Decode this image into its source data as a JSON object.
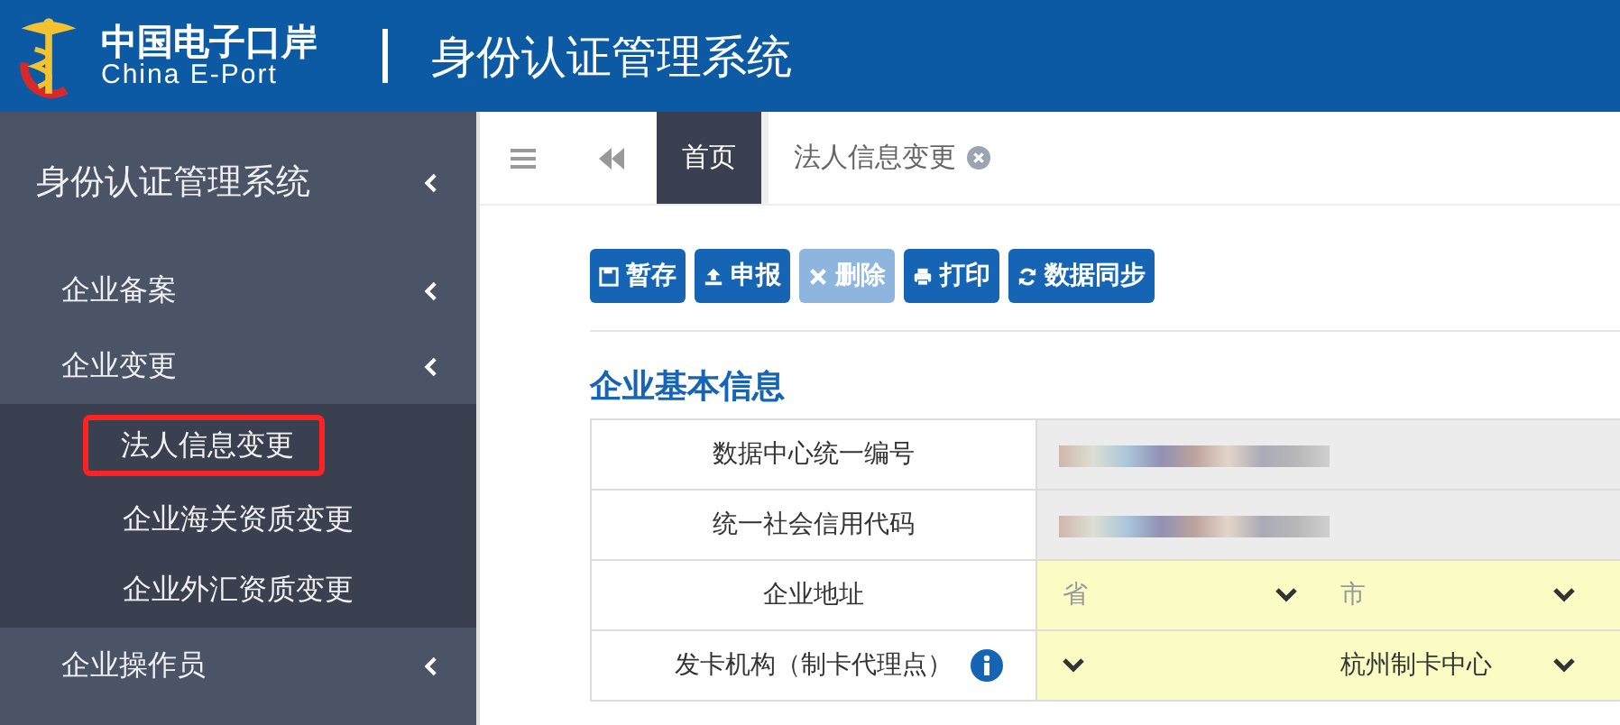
{
  "header": {
    "logo_cn": "中国电子口岸",
    "logo_en": "China E-Port",
    "system_title": "身份认证管理系统"
  },
  "sidebar": {
    "title": "身份认证管理系统",
    "items": [
      {
        "label": "企业备案"
      },
      {
        "label": "企业变更",
        "children": [
          {
            "label": "法人信息变更",
            "selected": true
          },
          {
            "label": "企业海关资质变更",
            "selected": false
          },
          {
            "label": "企业外汇资质变更",
            "selected": false
          }
        ]
      },
      {
        "label": "企业操作员"
      }
    ]
  },
  "tabs": [
    {
      "label": "首页",
      "kind": "home"
    },
    {
      "label": "法人信息变更",
      "kind": "page"
    }
  ],
  "toolbar": [
    {
      "label": "暂存",
      "kind": "save",
      "disabled": false
    },
    {
      "label": "申报",
      "kind": "upload",
      "disabled": false
    },
    {
      "label": "删除",
      "kind": "remove",
      "disabled": true
    },
    {
      "label": "打印",
      "kind": "print",
      "disabled": false
    },
    {
      "label": "数据同步",
      "kind": "refresh",
      "disabled": false
    }
  ],
  "section_title": "企业基本信息",
  "form_rows": [
    {
      "label": "数据中心统一编号",
      "info": false,
      "cells": [
        {
          "kind": "redacted"
        }
      ]
    },
    {
      "label": "统一社会信用代码",
      "info": false,
      "cells": [
        {
          "kind": "redacted"
        }
      ]
    },
    {
      "label": "企业地址",
      "info": false,
      "cells": [
        {
          "kind": "select",
          "placeholder": "省"
        },
        {
          "kind": "select",
          "placeholder": "市"
        }
      ]
    },
    {
      "label": "发卡机构（制卡代理点）",
      "info": true,
      "cells": [
        {
          "kind": "select"
        },
        {
          "kind": "select",
          "value": "杭州制卡中心"
        }
      ]
    }
  ]
}
